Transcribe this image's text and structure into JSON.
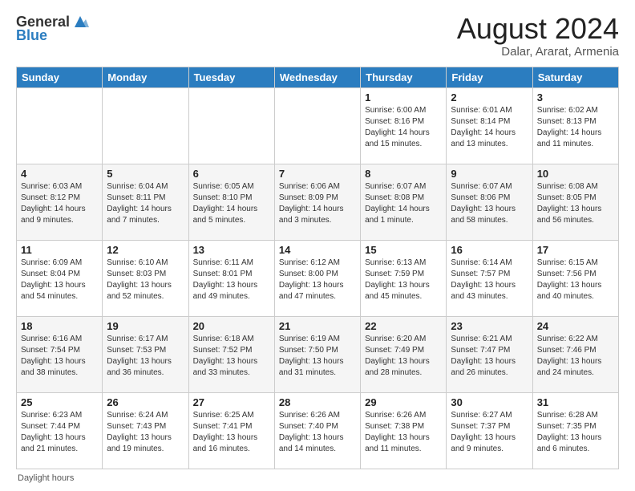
{
  "header": {
    "logo": {
      "general": "General",
      "blue": "Blue"
    },
    "title": "August 2024",
    "subtitle": "Dalar, Ararat, Armenia"
  },
  "days_of_week": [
    "Sunday",
    "Monday",
    "Tuesday",
    "Wednesday",
    "Thursday",
    "Friday",
    "Saturday"
  ],
  "footer": {
    "note": "Daylight hours"
  },
  "weeks": [
    [
      {
        "day": "",
        "info": ""
      },
      {
        "day": "",
        "info": ""
      },
      {
        "day": "",
        "info": ""
      },
      {
        "day": "",
        "info": ""
      },
      {
        "day": "1",
        "info": "Sunrise: 6:00 AM\nSunset: 8:16 PM\nDaylight: 14 hours\nand 15 minutes."
      },
      {
        "day": "2",
        "info": "Sunrise: 6:01 AM\nSunset: 8:14 PM\nDaylight: 14 hours\nand 13 minutes."
      },
      {
        "day": "3",
        "info": "Sunrise: 6:02 AM\nSunset: 8:13 PM\nDaylight: 14 hours\nand 11 minutes."
      }
    ],
    [
      {
        "day": "4",
        "info": "Sunrise: 6:03 AM\nSunset: 8:12 PM\nDaylight: 14 hours\nand 9 minutes."
      },
      {
        "day": "5",
        "info": "Sunrise: 6:04 AM\nSunset: 8:11 PM\nDaylight: 14 hours\nand 7 minutes."
      },
      {
        "day": "6",
        "info": "Sunrise: 6:05 AM\nSunset: 8:10 PM\nDaylight: 14 hours\nand 5 minutes."
      },
      {
        "day": "7",
        "info": "Sunrise: 6:06 AM\nSunset: 8:09 PM\nDaylight: 14 hours\nand 3 minutes."
      },
      {
        "day": "8",
        "info": "Sunrise: 6:07 AM\nSunset: 8:08 PM\nDaylight: 14 hours\nand 1 minute."
      },
      {
        "day": "9",
        "info": "Sunrise: 6:07 AM\nSunset: 8:06 PM\nDaylight: 13 hours\nand 58 minutes."
      },
      {
        "day": "10",
        "info": "Sunrise: 6:08 AM\nSunset: 8:05 PM\nDaylight: 13 hours\nand 56 minutes."
      }
    ],
    [
      {
        "day": "11",
        "info": "Sunrise: 6:09 AM\nSunset: 8:04 PM\nDaylight: 13 hours\nand 54 minutes."
      },
      {
        "day": "12",
        "info": "Sunrise: 6:10 AM\nSunset: 8:03 PM\nDaylight: 13 hours\nand 52 minutes."
      },
      {
        "day": "13",
        "info": "Sunrise: 6:11 AM\nSunset: 8:01 PM\nDaylight: 13 hours\nand 49 minutes."
      },
      {
        "day": "14",
        "info": "Sunrise: 6:12 AM\nSunset: 8:00 PM\nDaylight: 13 hours\nand 47 minutes."
      },
      {
        "day": "15",
        "info": "Sunrise: 6:13 AM\nSunset: 7:59 PM\nDaylight: 13 hours\nand 45 minutes."
      },
      {
        "day": "16",
        "info": "Sunrise: 6:14 AM\nSunset: 7:57 PM\nDaylight: 13 hours\nand 43 minutes."
      },
      {
        "day": "17",
        "info": "Sunrise: 6:15 AM\nSunset: 7:56 PM\nDaylight: 13 hours\nand 40 minutes."
      }
    ],
    [
      {
        "day": "18",
        "info": "Sunrise: 6:16 AM\nSunset: 7:54 PM\nDaylight: 13 hours\nand 38 minutes."
      },
      {
        "day": "19",
        "info": "Sunrise: 6:17 AM\nSunset: 7:53 PM\nDaylight: 13 hours\nand 36 minutes."
      },
      {
        "day": "20",
        "info": "Sunrise: 6:18 AM\nSunset: 7:52 PM\nDaylight: 13 hours\nand 33 minutes."
      },
      {
        "day": "21",
        "info": "Sunrise: 6:19 AM\nSunset: 7:50 PM\nDaylight: 13 hours\nand 31 minutes."
      },
      {
        "day": "22",
        "info": "Sunrise: 6:20 AM\nSunset: 7:49 PM\nDaylight: 13 hours\nand 28 minutes."
      },
      {
        "day": "23",
        "info": "Sunrise: 6:21 AM\nSunset: 7:47 PM\nDaylight: 13 hours\nand 26 minutes."
      },
      {
        "day": "24",
        "info": "Sunrise: 6:22 AM\nSunset: 7:46 PM\nDaylight: 13 hours\nand 24 minutes."
      }
    ],
    [
      {
        "day": "25",
        "info": "Sunrise: 6:23 AM\nSunset: 7:44 PM\nDaylight: 13 hours\nand 21 minutes."
      },
      {
        "day": "26",
        "info": "Sunrise: 6:24 AM\nSunset: 7:43 PM\nDaylight: 13 hours\nand 19 minutes."
      },
      {
        "day": "27",
        "info": "Sunrise: 6:25 AM\nSunset: 7:41 PM\nDaylight: 13 hours\nand 16 minutes."
      },
      {
        "day": "28",
        "info": "Sunrise: 6:26 AM\nSunset: 7:40 PM\nDaylight: 13 hours\nand 14 minutes."
      },
      {
        "day": "29",
        "info": "Sunrise: 6:26 AM\nSunset: 7:38 PM\nDaylight: 13 hours\nand 11 minutes."
      },
      {
        "day": "30",
        "info": "Sunrise: 6:27 AM\nSunset: 7:37 PM\nDaylight: 13 hours\nand 9 minutes."
      },
      {
        "day": "31",
        "info": "Sunrise: 6:28 AM\nSunset: 7:35 PM\nDaylight: 13 hours\nand 6 minutes."
      }
    ]
  ]
}
